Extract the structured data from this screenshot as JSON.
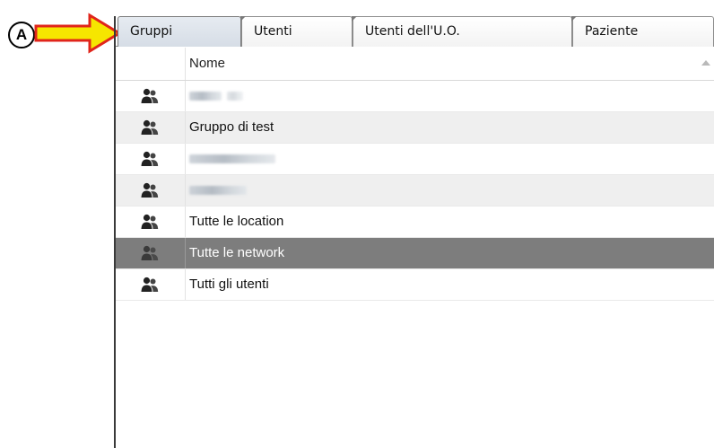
{
  "callout": {
    "badge_label": "A"
  },
  "tabs": [
    {
      "label": "Gruppi",
      "active": true
    },
    {
      "label": "Utenti",
      "active": false
    },
    {
      "label": "Utenti dell'U.O.",
      "active": false
    },
    {
      "label": "Paziente",
      "active": false
    }
  ],
  "grid": {
    "column_name": "Nome",
    "rows": [
      {
        "label": "",
        "obscured": true
      },
      {
        "label": "Gruppo di test",
        "obscured": false
      },
      {
        "label": "",
        "obscured": true
      },
      {
        "label": "",
        "obscured": true
      },
      {
        "label": "Tutte le location",
        "obscured": false
      },
      {
        "label": "Tutte le network",
        "obscured": false,
        "selected": true
      },
      {
        "label": "Tutti gli utenti",
        "obscured": false
      }
    ]
  },
  "colors": {
    "arrow_fill": "#f6e600",
    "arrow_outline": "#e0251b",
    "selected_row": "#7d7d7d",
    "alt_row": "#efefef"
  },
  "icons": {
    "row_icon": "users-group-icon",
    "sort_icon": "sort-ascending-icon"
  }
}
